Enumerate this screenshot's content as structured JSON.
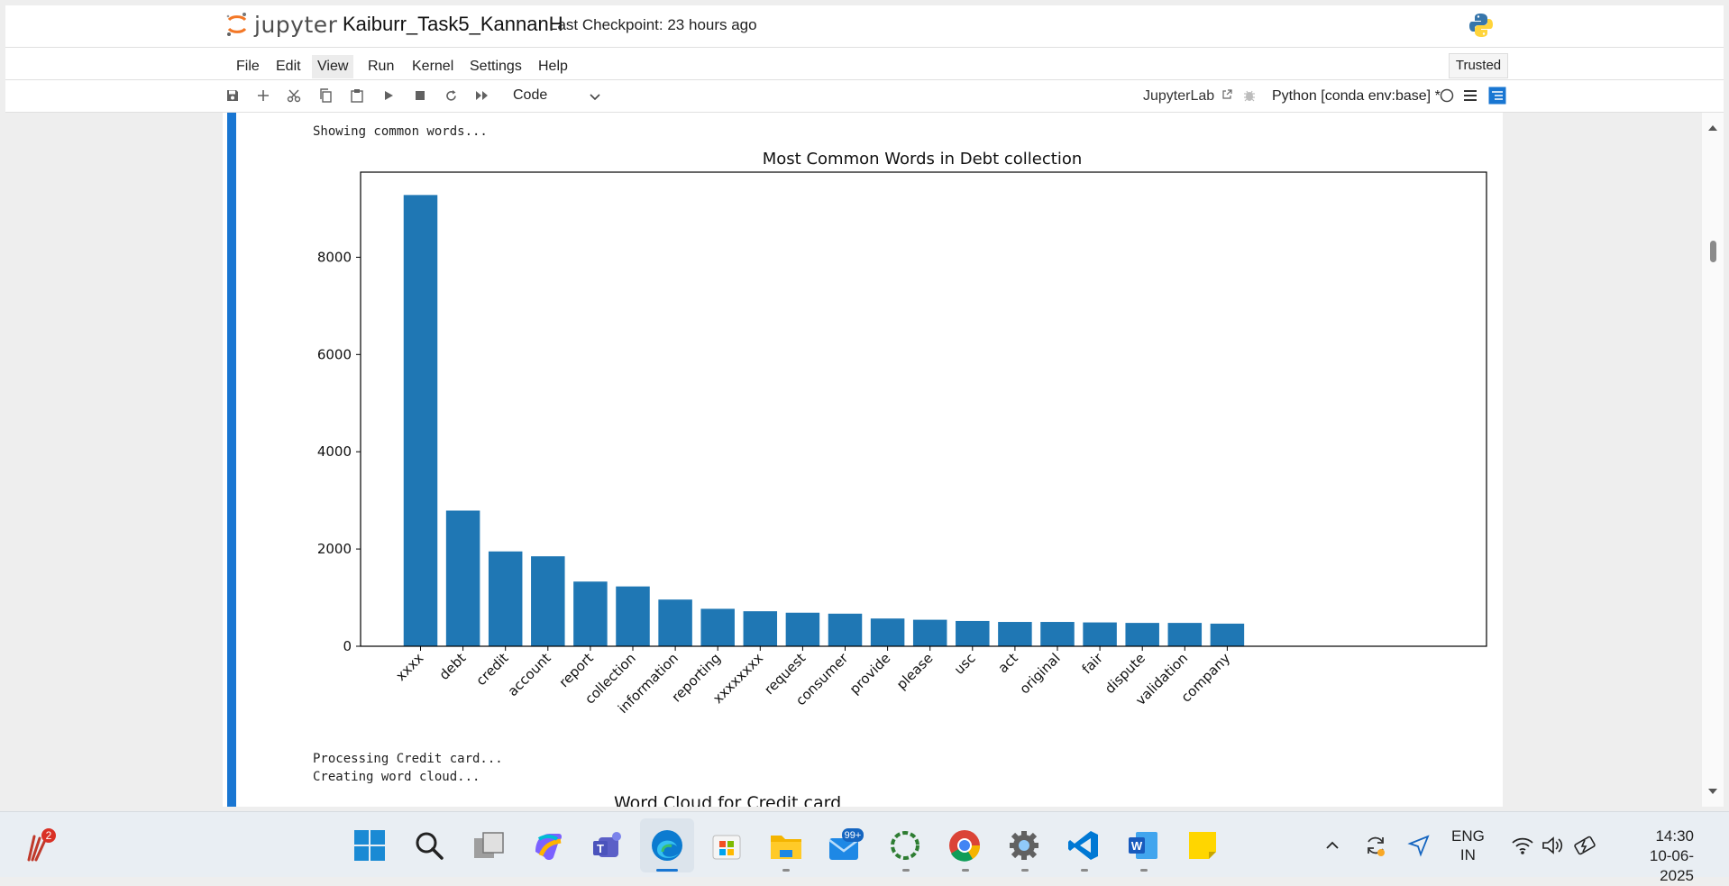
{
  "header": {
    "logo_text": "jupyter",
    "notebook_title": "Kaiburr_Task5_KannanH",
    "checkpoint": "Last Checkpoint: 23 hours ago"
  },
  "menu": [
    "File",
    "Edit",
    "View",
    "Run",
    "Kernel",
    "Settings",
    "Help"
  ],
  "trusted_label": "Trusted",
  "toolbar": {
    "cell_type": "Code",
    "jupyterlab_label": "JupyterLab",
    "kernel_label": "Python [conda env:base] *"
  },
  "output": {
    "line1": "Showing common words...",
    "line2": "Processing Credit card...",
    "line3": "Creating word cloud...",
    "next_title": "Word Cloud for Credit card"
  },
  "chart_data": {
    "type": "bar",
    "title": "Most Common Words in Debt collection",
    "xlabel": "",
    "ylabel": "",
    "categories": [
      "xxxx",
      "debt",
      "credit",
      "account",
      "report",
      "collection",
      "information",
      "reporting",
      "xxxxxxxx",
      "request",
      "consumer",
      "provide",
      "please",
      "usc",
      "act",
      "original",
      "fair",
      "dispute",
      "validation",
      "company"
    ],
    "values": [
      9280,
      2790,
      1950,
      1850,
      1330,
      1230,
      960,
      770,
      720,
      690,
      670,
      570,
      545,
      520,
      500,
      500,
      490,
      480,
      480,
      465
    ],
    "yticks": [
      0,
      2000,
      4000,
      6000,
      8000
    ],
    "ylim": [
      0,
      9750
    ],
    "bar_color": "#1f77b4",
    "grid": false
  },
  "taskbar": {
    "notification_badge": "2",
    "mail_badge": "99+",
    "lang_line1": "ENG",
    "lang_line2": "IN",
    "time": "14:30",
    "date": "10-06-2025"
  }
}
